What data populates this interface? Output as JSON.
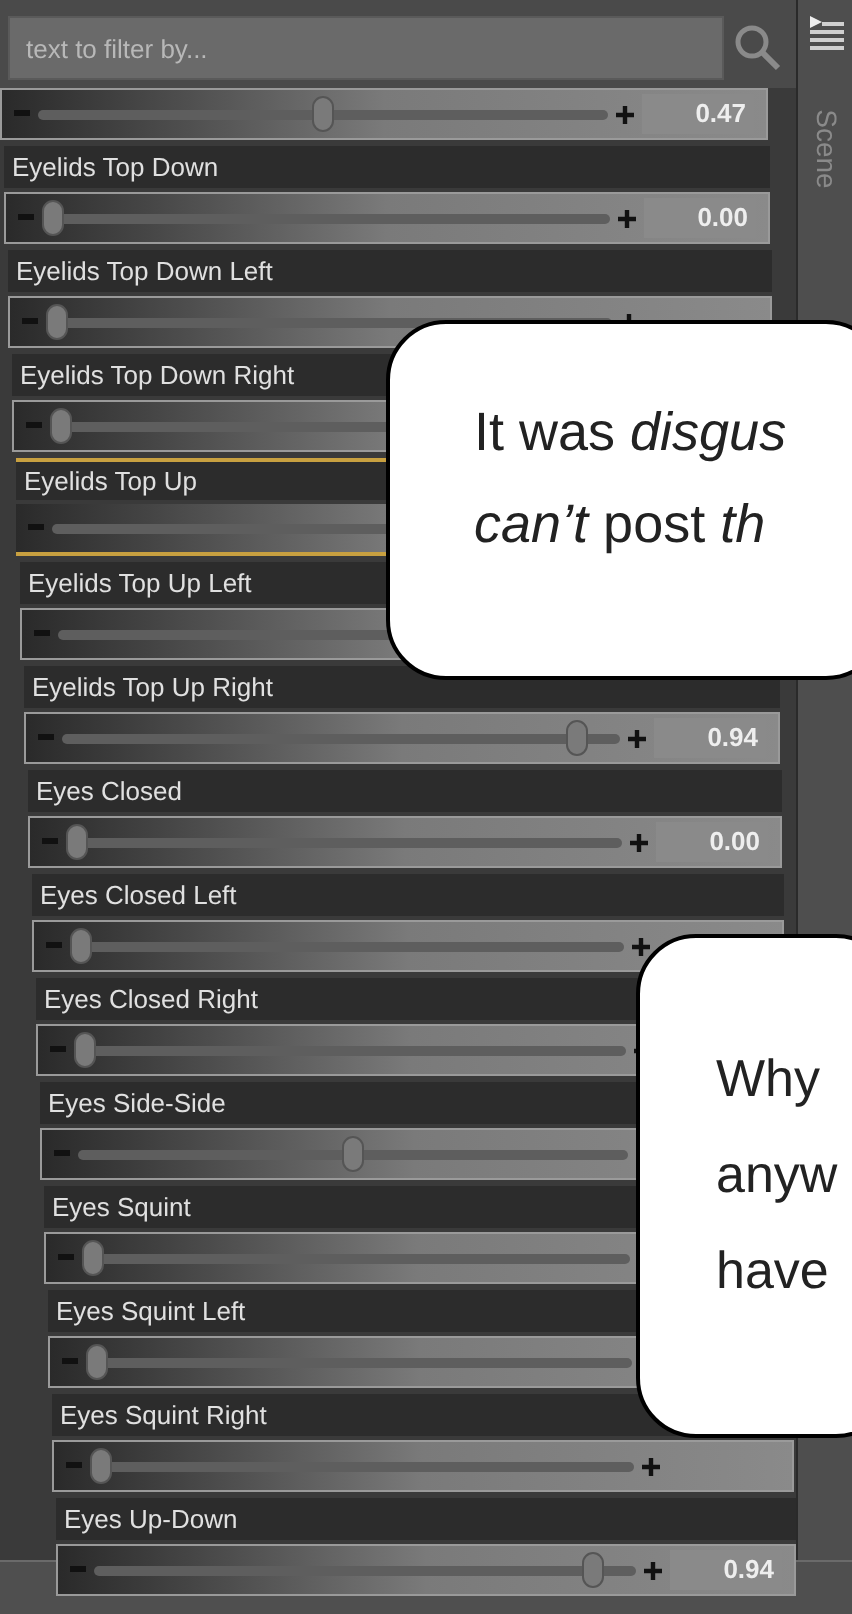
{
  "search": {
    "placeholder": "text to filter by..."
  },
  "side_tab": {
    "label": "Scene"
  },
  "rows": [
    {
      "value": "0.47",
      "level": 0.5,
      "selected": false
    },
    {
      "label": "Eyelids Top Down",
      "value": "0.00",
      "level": 0,
      "selected": false
    },
    {
      "label": "Eyelids Top Down Left",
      "level": 0,
      "selected": false
    },
    {
      "label": "Eyelids Top Down Right",
      "level": 0,
      "selected": false
    },
    {
      "label": "Eyelids Top Up",
      "selected": true
    },
    {
      "label": "Eyelids Top Up Left",
      "selected": false
    },
    {
      "label": "Eyelids Top Up Right",
      "value": "0.94",
      "level": 0.94,
      "selected": false
    },
    {
      "label": "Eyes Closed",
      "value": "0.00",
      "level": 0,
      "selected": false
    },
    {
      "label": "Eyes Closed Left",
      "level": 0,
      "selected": false
    },
    {
      "label": "Eyes Closed Right",
      "level": 0,
      "selected": false
    },
    {
      "label": "Eyes Side-Side",
      "level": 0.5,
      "selected": false
    },
    {
      "label": "Eyes Squint",
      "level": 0,
      "selected": false
    },
    {
      "label": "Eyes Squint Left",
      "level": 0,
      "selected": false
    },
    {
      "label": "Eyes Squint Right",
      "level": 0,
      "selected": false
    },
    {
      "label": "Eyes Up-Down",
      "value": "0.94",
      "level": 0.94,
      "selected": false
    }
  ],
  "bubbles": [
    {
      "lines": [
        "It was *disgus*",
        "*can’t* post *th*"
      ]
    },
    {
      "lines": [
        "Why",
        "anyw",
        "have"
      ]
    }
  ]
}
